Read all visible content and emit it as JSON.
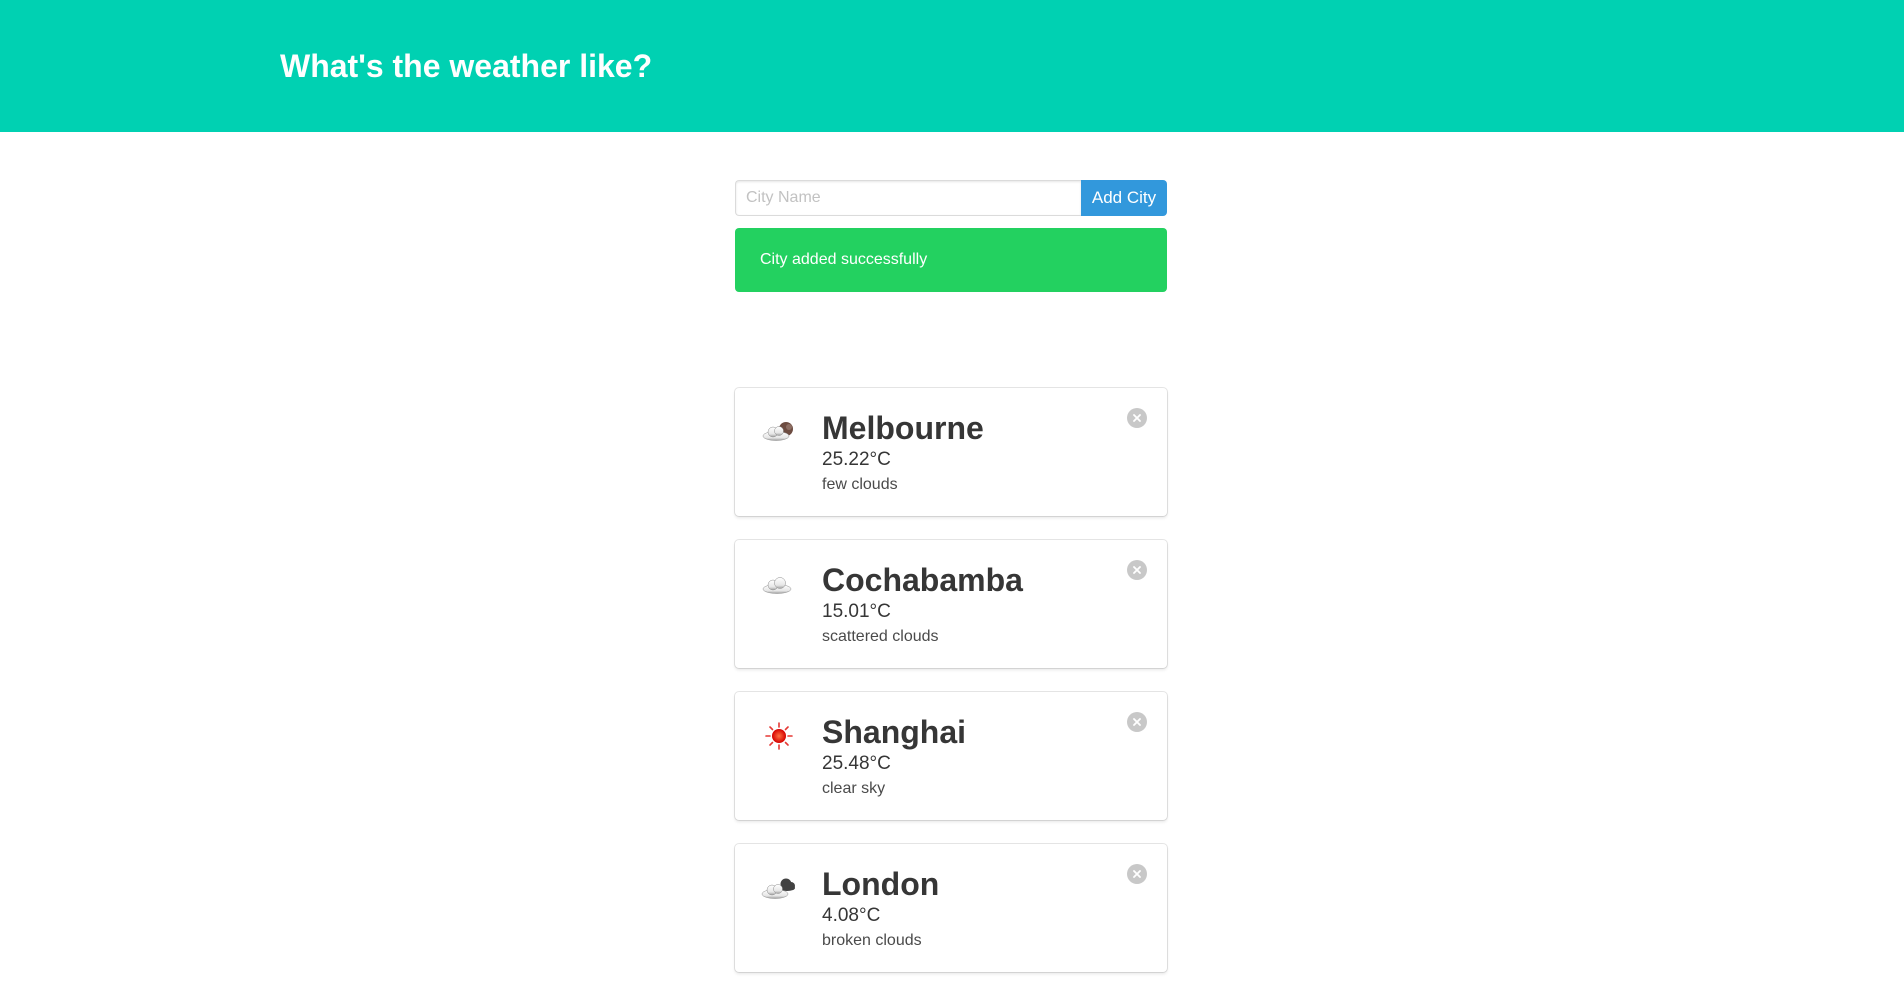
{
  "header": {
    "title": "What's the weather like?"
  },
  "form": {
    "placeholder": "City Name",
    "value": "",
    "button_label": "Add City"
  },
  "notification": {
    "message": "City added successfully",
    "color": "#23d160"
  },
  "colors": {
    "hero": "#00d1b2",
    "button": "#3298dc"
  },
  "cities": [
    {
      "name": "Melbourne",
      "temperature": "25.22°C",
      "description": "few clouds",
      "icon": "few-clouds-icon"
    },
    {
      "name": "Cochabamba",
      "temperature": "15.01°C",
      "description": "scattered clouds",
      "icon": "scattered-clouds-icon"
    },
    {
      "name": "Shanghai",
      "temperature": "25.48°C",
      "description": "clear sky",
      "icon": "clear-sky-icon"
    },
    {
      "name": "London",
      "temperature": "4.08°C",
      "description": "broken clouds",
      "icon": "broken-clouds-icon"
    }
  ]
}
